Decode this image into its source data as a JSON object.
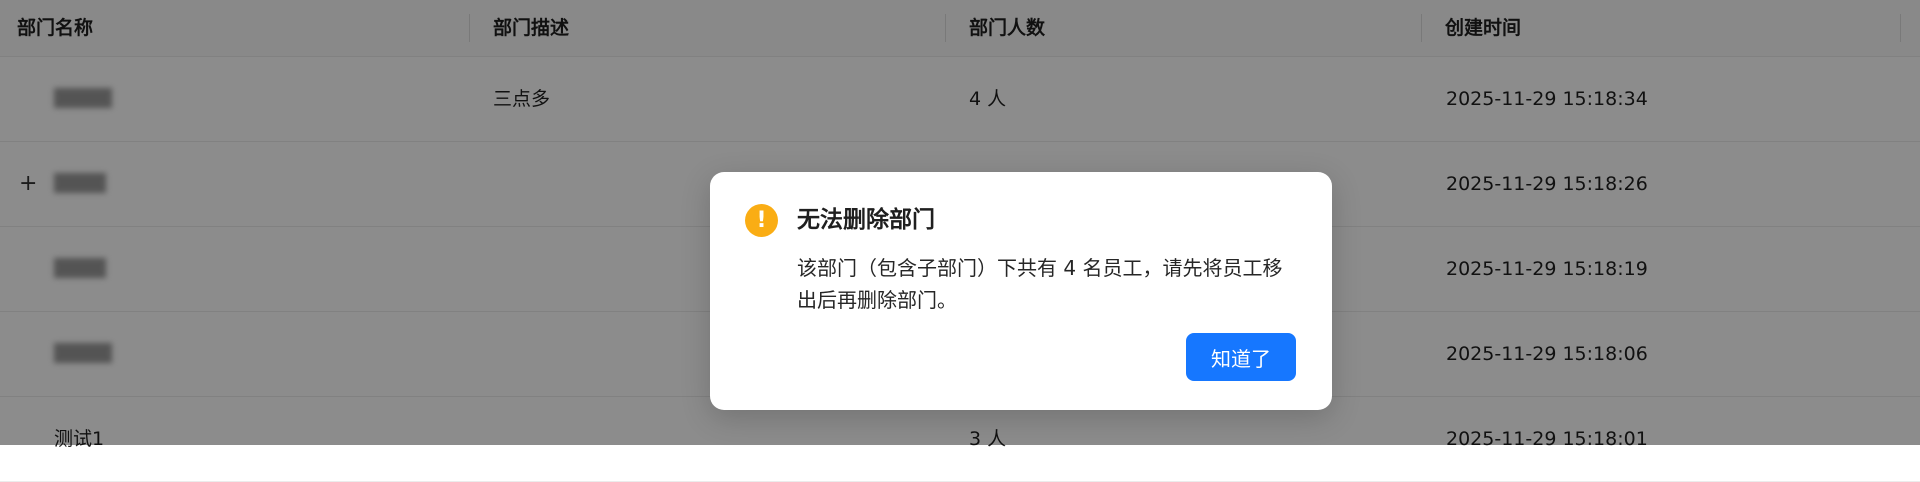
{
  "table": {
    "headers": [
      "部门名称",
      "部门描述",
      "部门人数",
      "创建时间"
    ],
    "rows": [
      {
        "description": "三点多",
        "members": "4 人",
        "created": "2025-11-29 15:18:34"
      },
      {
        "description": "",
        "members": "",
        "created": "2025-11-29 15:18:26"
      },
      {
        "description": "",
        "members": "",
        "created": "2025-11-29 15:18:19"
      },
      {
        "description": "",
        "members": "",
        "created": "2025-11-29 15:18:06"
      },
      {
        "name": "测试1",
        "description": "",
        "members": "3 人",
        "created": "2025-11-29 15:18:01"
      }
    ]
  },
  "expand_symbol": "+",
  "dialog": {
    "icon_symbol": "!",
    "title": "无法删除部门",
    "message": "该部门（包含子部门）下共有 4 名员工，请先将员工移出后再删除部门。",
    "ok_label": "知道了"
  },
  "colors": {
    "primary": "#1677ff",
    "warning": "#faad14",
    "mask": "rgba(0,0,0,0.45)"
  }
}
